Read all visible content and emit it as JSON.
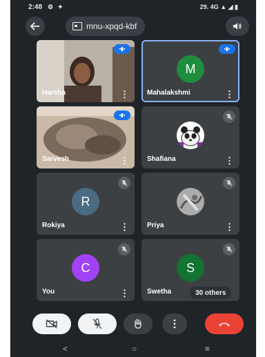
{
  "status": {
    "time": "2:48",
    "right": "29. 4G ▲ ◢ ▮"
  },
  "meeting": {
    "code": "mnu-xpqd-kbf"
  },
  "participants": [
    {
      "name": "Harsha",
      "type": "video",
      "state": "speaking"
    },
    {
      "name": "Mahalakshmi",
      "type": "avatar",
      "initial": "M",
      "color": "#1e8e3e",
      "state": "speaking"
    },
    {
      "name": "Sarvesh",
      "type": "video",
      "state": "speaking"
    },
    {
      "name": "Shafiana",
      "type": "image-avatar",
      "state": "muted"
    },
    {
      "name": "Rokiya",
      "type": "avatar",
      "initial": "R",
      "color": "#4a6b82",
      "state": "muted"
    },
    {
      "name": "Priya",
      "type": "image-avatar",
      "state": "muted"
    },
    {
      "name": "You",
      "type": "avatar",
      "initial": "C",
      "color": "#a142f4",
      "state": "muted"
    },
    {
      "name": "Swetha",
      "type": "avatar",
      "initial": "S",
      "color": "#137333",
      "state": "muted"
    }
  ],
  "others_label": "30 others",
  "more_glyph": "⋮",
  "icons": {
    "back": "arrow-left-icon",
    "meeting": "meeting-icon",
    "speaker": "speaker-icon",
    "camera": "camera-off-icon",
    "mic": "mic-off-icon",
    "hand": "hand-raise-icon",
    "more": "more-vert-icon",
    "hangup": "hang-up-icon"
  },
  "colors": {
    "accent": "#8ab4f8",
    "hangup": "#ea4335",
    "speaking": "#1a73e8"
  }
}
